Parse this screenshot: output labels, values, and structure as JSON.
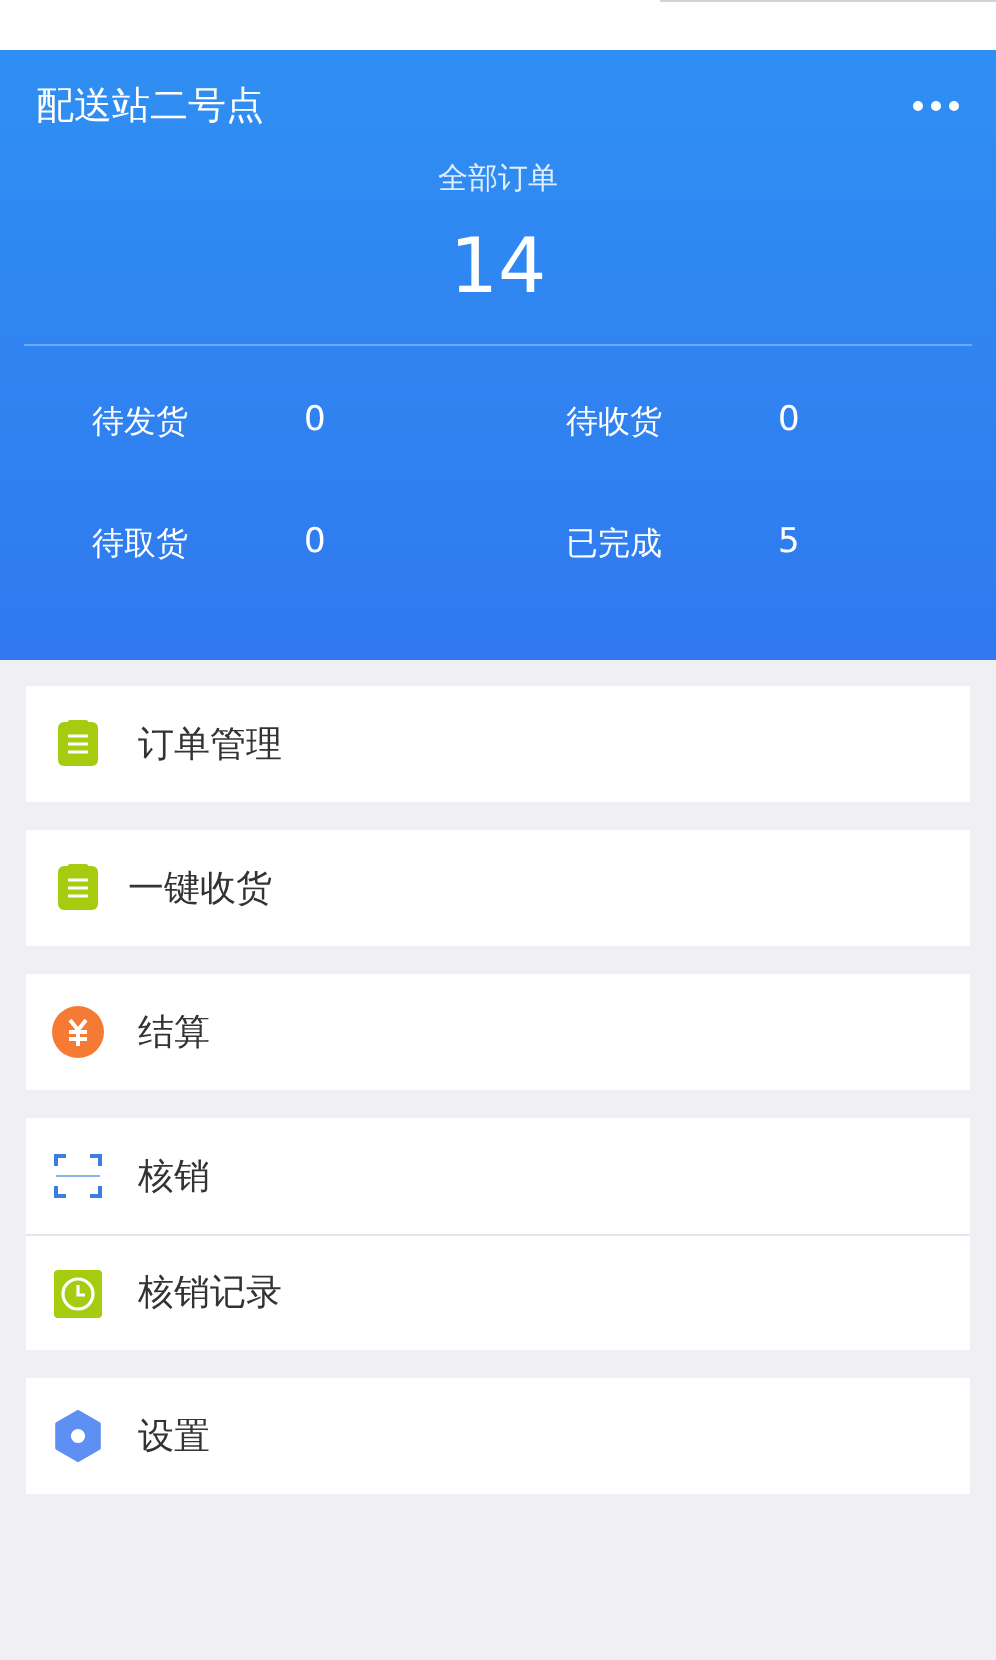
{
  "header": {
    "title": "配送站二号点",
    "total": {
      "label": "全部订单",
      "value": "14"
    },
    "stats": [
      {
        "label": "待发货",
        "value": "0"
      },
      {
        "label": "待收货",
        "value": "0"
      },
      {
        "label": "待取货",
        "value": "0"
      },
      {
        "label": "已完成",
        "value": "5"
      }
    ]
  },
  "menu": [
    {
      "items": [
        {
          "kind": "list",
          "label": "订单管理"
        }
      ]
    },
    {
      "items": [
        {
          "kind": "list",
          "label": "一键收货"
        }
      ]
    },
    {
      "items": [
        {
          "kind": "yen",
          "label": "结算"
        }
      ]
    },
    {
      "items": [
        {
          "kind": "scan",
          "label": "核销"
        },
        {
          "kind": "clock",
          "label": "核销记录"
        }
      ]
    },
    {
      "items": [
        {
          "kind": "gear",
          "label": "设置"
        }
      ]
    }
  ]
}
